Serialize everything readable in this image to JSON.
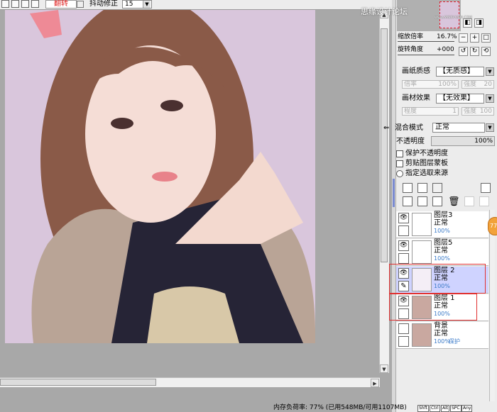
{
  "toolbar": {
    "flip_label": "翻转",
    "stabilizer_label": "抖动修正",
    "stabilizer_value": "15"
  },
  "watermark": {
    "text": "思缘设计论坛",
    "url": "www.MISSVUAN.COM"
  },
  "navigator": {
    "zoom_label": "缩放倍率",
    "zoom_value": "16.7%",
    "rotate_label": "旋转角度",
    "rotate_value": "+000"
  },
  "paper": {
    "texture_label": "画纸质感",
    "texture_value": "【无质感】",
    "texture_scale_label": "倍率",
    "texture_scale_value": "100%",
    "texture_strength_label": "强度",
    "texture_strength_value": "20",
    "effect_label": "画材效果",
    "effect_value": "【无效果】",
    "effect_degree_label": "程度",
    "effect_degree_value": "1",
    "effect_strength_label": "强度",
    "effect_strength_value": "100"
  },
  "blend": {
    "mode_label": "混合模式",
    "mode_value": "正常",
    "opacity_label": "不透明度",
    "opacity_value": "100%"
  },
  "options": {
    "protect_opacity": "保护不透明度",
    "clip_mask": "剪贴图层蒙板",
    "selection_source": "指定选取来源"
  },
  "layers": [
    {
      "name": "图层3",
      "mode": "正常",
      "opacity": "100%",
      "protect": "",
      "selected": false
    },
    {
      "name": "图层5",
      "mode": "正常",
      "opacity": "100%",
      "protect": "",
      "selected": false
    },
    {
      "name": "图层 2",
      "mode": "正常",
      "opacity": "100%",
      "protect": "",
      "selected": true
    },
    {
      "name": "图层 1",
      "mode": "正常",
      "opacity": "100%",
      "protect": "",
      "selected": false
    },
    {
      "name": "背景",
      "mode": "正常",
      "opacity": "100%",
      "protect": "保护",
      "selected": false
    }
  ],
  "side_badge": "77",
  "status": {
    "text": "内存负荷率: 77% (已用548MB/可用1107MB)",
    "buttons": [
      "Shft",
      "Ctrl",
      "Alt",
      "SPC",
      "Any"
    ]
  },
  "colors": {
    "canvas_bg": "#d9c6dc",
    "selected_layer": "#cfd3ff",
    "highlight_box": "#e03030",
    "accent_text": "#3a7ac8",
    "flip_text": "#e02020"
  }
}
